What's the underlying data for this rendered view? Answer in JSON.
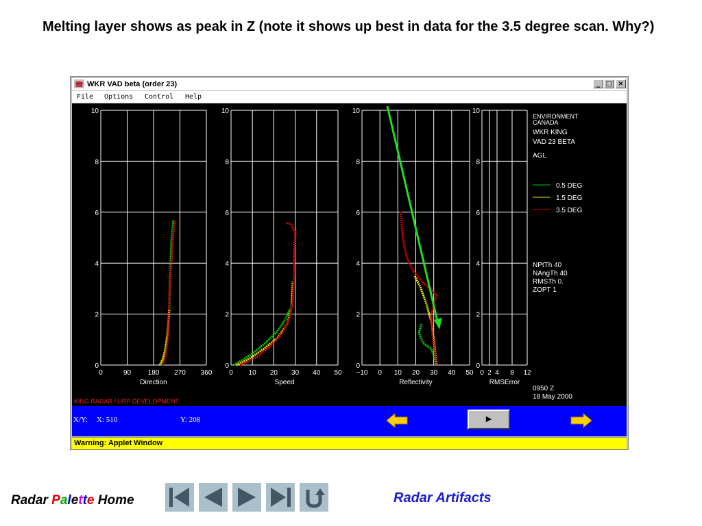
{
  "slide": {
    "title": "Melting layer shows as peak in Z (note it shows up best in data for the 3.5 degree scan. Why?)"
  },
  "window": {
    "title": "WKR VAD beta (order 23)",
    "controls": {
      "minimize": "_",
      "maximize": "□",
      "close": "×"
    },
    "menu": [
      "File",
      "Options",
      "Control",
      "Help"
    ]
  },
  "plots": {
    "y_ticks": [
      "0",
      "2",
      "4",
      "6",
      "8",
      "10"
    ],
    "panels": [
      {
        "xlabel": "Direction",
        "xticks": [
          "0",
          "90",
          "180",
          "270",
          "360"
        ]
      },
      {
        "xlabel": "Speed",
        "xticks": [
          "0",
          "10",
          "20",
          "30",
          "40",
          "50"
        ]
      },
      {
        "xlabel": "Reflectivity",
        "xticks": [
          "−10",
          "0",
          "10",
          "20",
          "30",
          "40",
          "50"
        ]
      },
      {
        "xlabel": "RMSError",
        "xticks": [
          "0",
          "2",
          "4",
          "8",
          "12"
        ]
      }
    ],
    "info": {
      "org_line1": "ENVIRONMENT",
      "org_line2": "CANADA",
      "station": "WKR   KING",
      "vad": "VAD   23    BETA",
      "agl": "AGL",
      "params": [
        "NPtTh    40",
        "NAngTh 40",
        "RMSTh   0.",
        "ZOPT     1"
      ],
      "time": "0950 Z",
      "date": "18 May 2000"
    },
    "legend": [
      {
        "label": "0.5 DEG",
        "color": "#00cc00"
      },
      {
        "label": "1.5 DEG",
        "color": "#e8e800"
      },
      {
        "label": "3.5 DEG",
        "color": "#dd0000"
      }
    ],
    "credit": "KING RADAR / URP DEVELOPMENT"
  },
  "controlbar": {
    "x_label": "X/Y:",
    "x_value": "X: 510",
    "y_value": "Y: 208",
    "play_symbol": "▶"
  },
  "warning": "Warning: Applet Window",
  "footer": {
    "home_prefix": "Radar ",
    "palette_letters": [
      {
        "ch": "P",
        "color": "#dd0000"
      },
      {
        "ch": "a",
        "color": "#00aa00"
      },
      {
        "ch": "l",
        "color": "#0000ee"
      },
      {
        "ch": "e",
        "color": "#000000"
      },
      {
        "ch": "t",
        "color": "#dd00dd"
      },
      {
        "ch": "t",
        "color": "#0000ee"
      },
      {
        "ch": "e",
        "color": "#dd0000"
      }
    ],
    "home_suffix": " Home",
    "artifacts_link": "Radar Artifacts"
  },
  "colors": {
    "plot_bg": "#000000",
    "grid": "#ffffff",
    "control_bg": "#0000ff",
    "warning_bg": "#ffff00",
    "nav_btn": "#a9bfca",
    "annotation_arrow": "#22dd22"
  }
}
